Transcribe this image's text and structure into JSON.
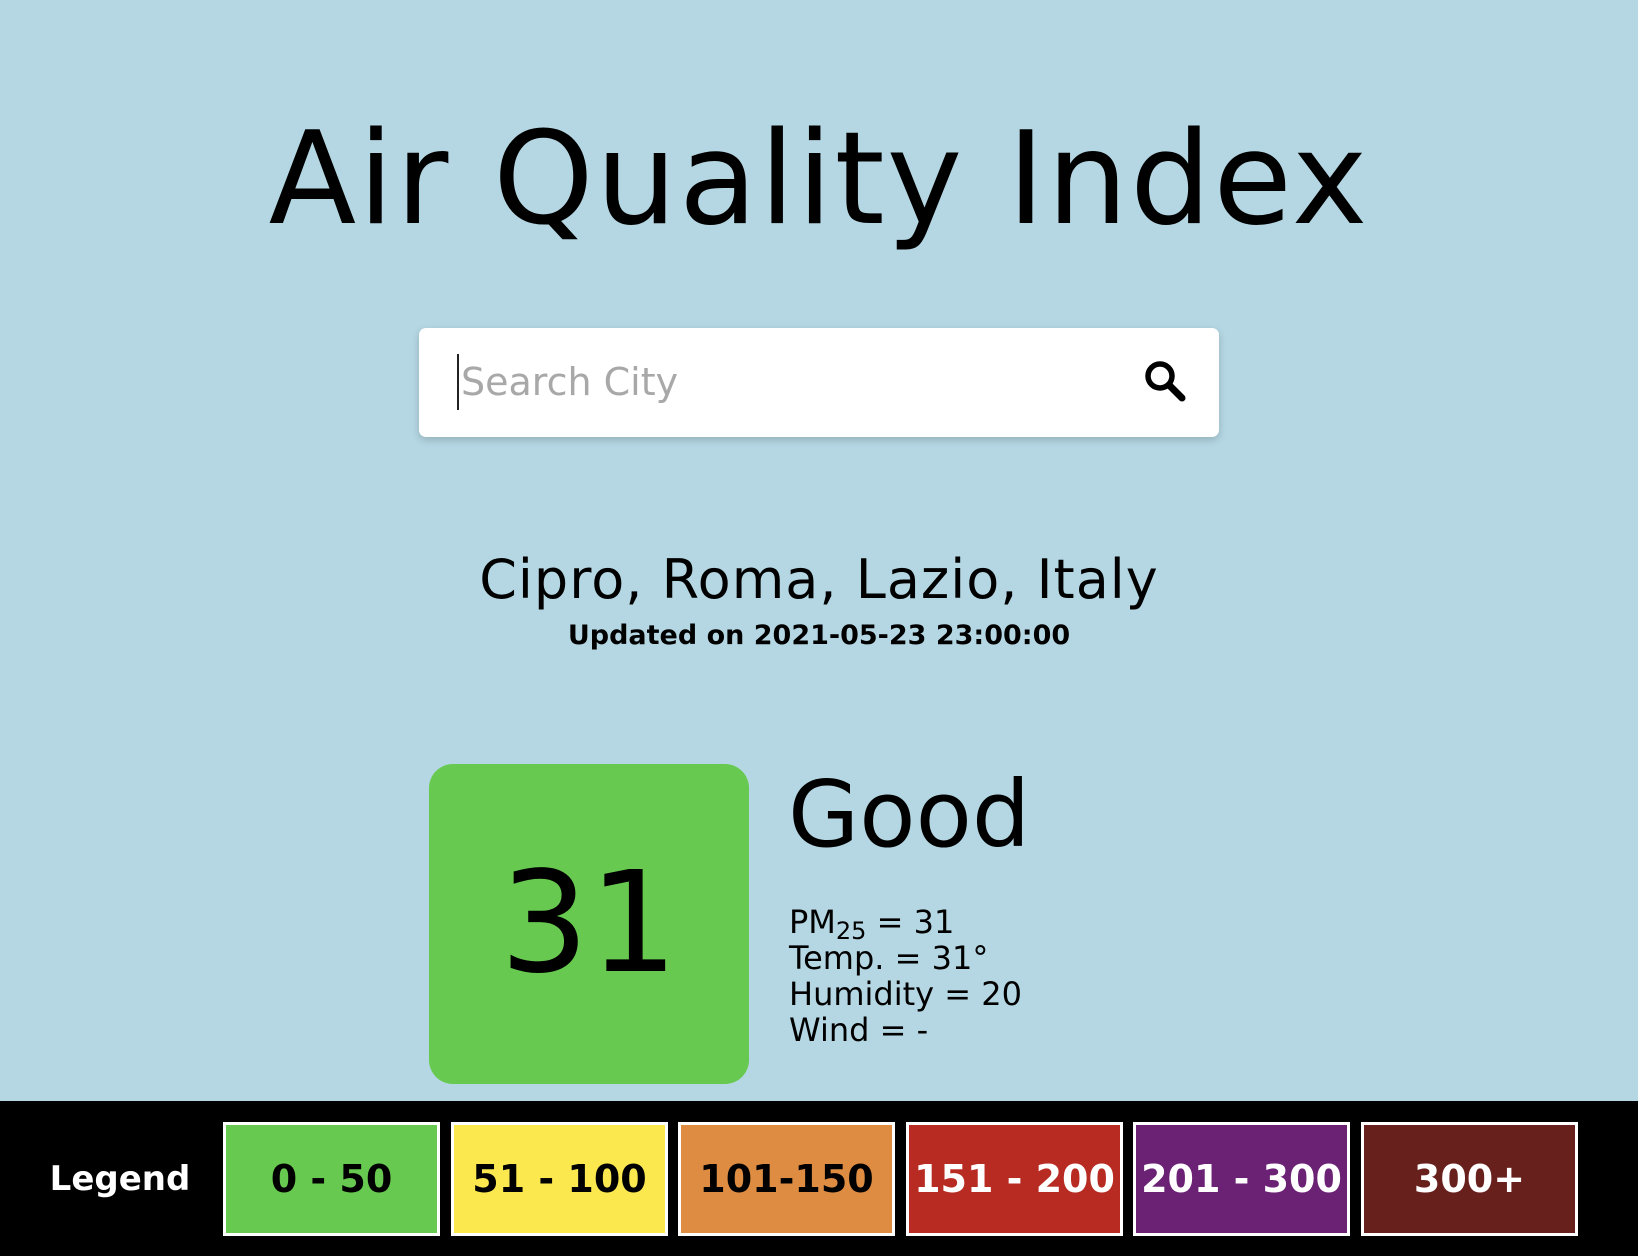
{
  "header": {
    "title": "Air Quality Index"
  },
  "search": {
    "placeholder": "Search City",
    "value": ""
  },
  "location": {
    "name": "Cipro, Roma, Lazio, Italy",
    "updated": "Updated on 2021-05-23 23:00:00"
  },
  "aqi": {
    "value": "31",
    "status": "Good",
    "color": "#67c94f"
  },
  "details": {
    "pm_label": "PM",
    "pm_sub": "25",
    "pm_value": " = 31",
    "temp": "Temp. = 31°",
    "humidity": "Humidity = 20",
    "wind": "Wind = -"
  },
  "legend": {
    "label": "Legend",
    "items": [
      {
        "label": "0 - 50",
        "color": "#67c94f",
        "text_color": "#000000"
      },
      {
        "label": "51 - 100",
        "color": "#fbe84f",
        "text_color": "#000000"
      },
      {
        "label": "101-150",
        "color": "#de8c42",
        "text_color": "#000000"
      },
      {
        "label": "151 - 200",
        "color": "#b82b22",
        "text_color": "#ffffff"
      },
      {
        "label": "201 - 300",
        "color": "#6b2275",
        "text_color": "#ffffff"
      },
      {
        "label": "300+",
        "color": "#68201c",
        "text_color": "#ffffff"
      }
    ]
  },
  "icons": {
    "search": "search-icon"
  }
}
